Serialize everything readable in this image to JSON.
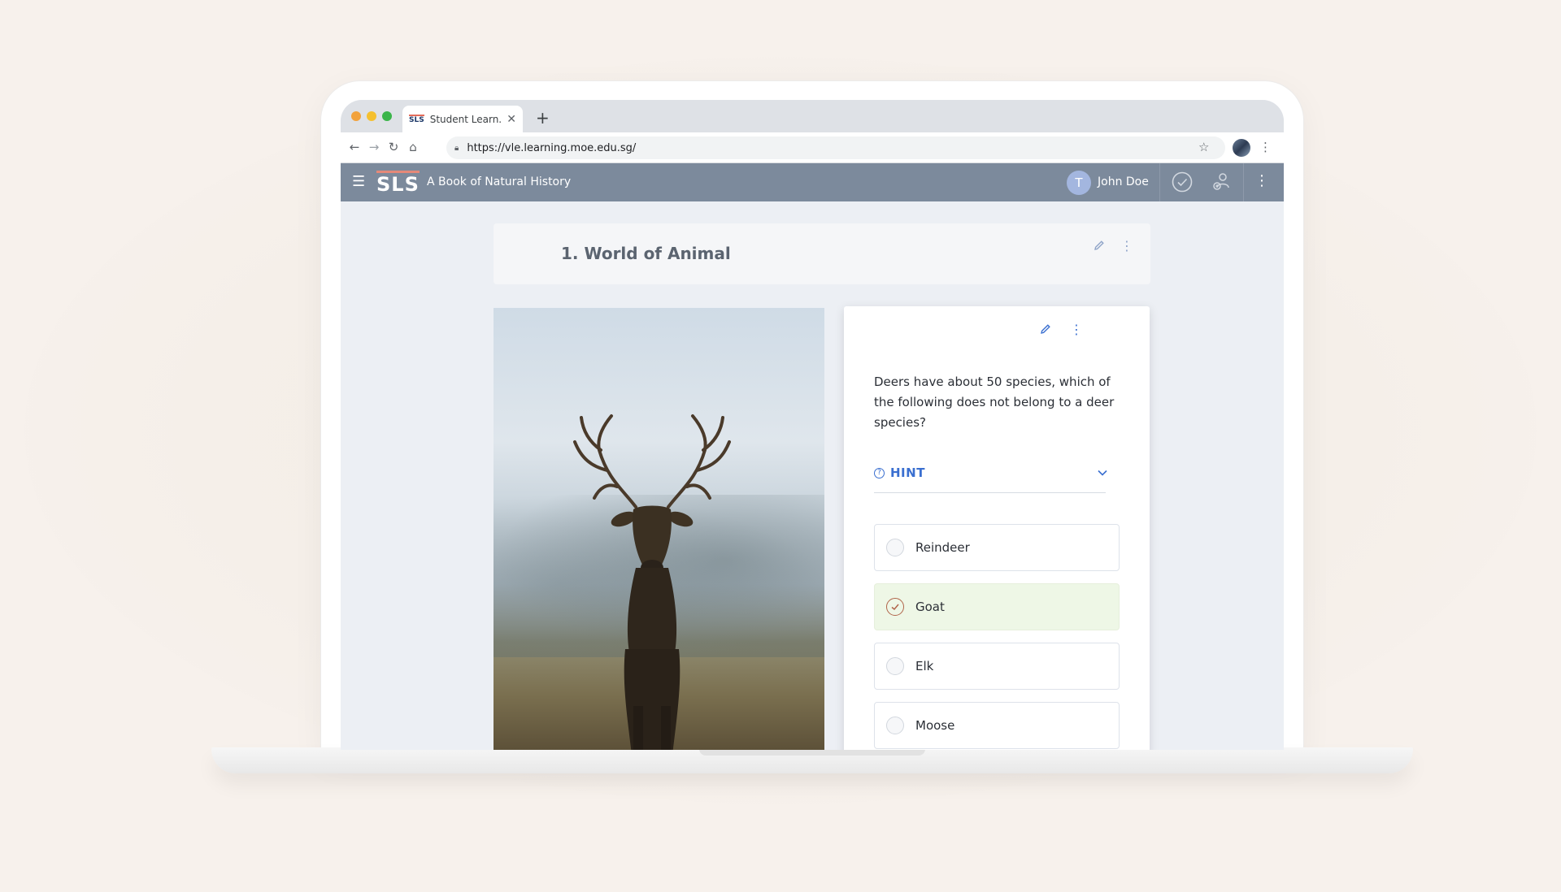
{
  "browser": {
    "tab_title": "Student Learn...",
    "tab_favicon_text": "SLS",
    "url": "https://vle.learning.moe.edu.sg/"
  },
  "appbar": {
    "logo_text": "SLS",
    "title": "A Book of Natural History",
    "user_initial": "T",
    "user_name": "John Doe"
  },
  "section": {
    "title": "1. World of Animal"
  },
  "question": {
    "text": "Deers have about 50 species, which of the following does not belong to a deer species?",
    "hint_label": "HINT",
    "options": [
      {
        "label": "Reindeer",
        "selected": false
      },
      {
        "label": "Goat",
        "selected": true
      },
      {
        "label": "Elk",
        "selected": false
      },
      {
        "label": "Moose",
        "selected": false
      }
    ]
  },
  "colors": {
    "accent_blue": "#3a6fd0",
    "appbar": "#7c8a9c",
    "selected_option_bg": "#eef7e6"
  },
  "icons": [
    "back-icon",
    "forward-icon",
    "reload-icon",
    "home-icon",
    "lock-icon",
    "star-icon",
    "menu-icon",
    "check-circle-icon",
    "people-icon",
    "edit-icon",
    "kebab-icon",
    "chevron-down-icon",
    "help-icon"
  ]
}
